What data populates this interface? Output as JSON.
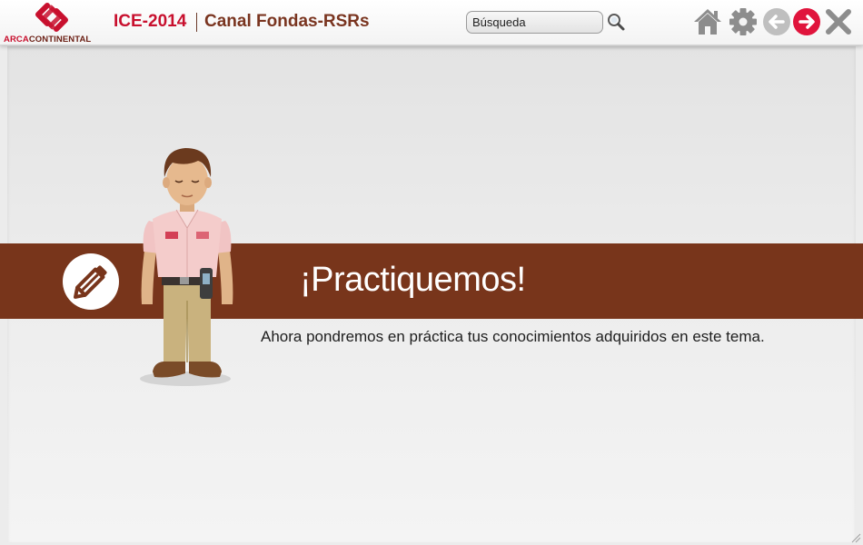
{
  "header": {
    "logo": {
      "part1": "ARCA",
      "part2": "CONTINENTAL",
      "icon": "arca-continental-logo"
    },
    "course_code": "ICE-2014",
    "course_title": "Canal Fondas-RSRs",
    "search": {
      "value": "Búsqueda",
      "placeholder": "Búsqueda",
      "icon": "search-icon"
    },
    "nav": [
      {
        "name": "home-button",
        "icon": "home-icon"
      },
      {
        "name": "settings-button",
        "icon": "gear-icon"
      },
      {
        "name": "back-button",
        "icon": "arrow-left-icon",
        "state": "disabled"
      },
      {
        "name": "next-button",
        "icon": "arrow-right-icon",
        "state": "active"
      },
      {
        "name": "close-button",
        "icon": "close-icon"
      }
    ]
  },
  "main": {
    "banner": {
      "title": "¡Practiquemos!",
      "icon": "pencil-icon"
    },
    "body_text": "Ahora pondremos en práctica tus conocimientos adquiridos en este tema.",
    "character": "sales-representative-illustration"
  },
  "colors": {
    "brand_red": "#c8102e",
    "banner_brown": "#78351b",
    "title_brown": "#7a3520",
    "next_active": "#e0143c",
    "icon_gray": "#8d8d8d",
    "disabled_gray": "#bfbfbf"
  }
}
